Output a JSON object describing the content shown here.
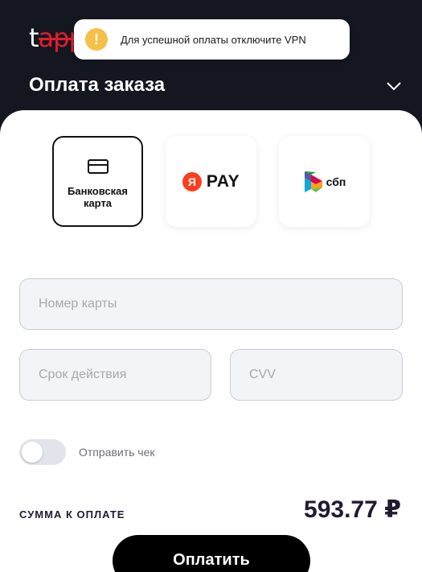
{
  "logo": {
    "part1": "t",
    "part2": "app"
  },
  "toast": {
    "icon": "!",
    "text": "Для успешной оплаты отключите VPN"
  },
  "header": {
    "title": "Оплата заказа"
  },
  "methods": {
    "card": {
      "label_line1": "Банковская",
      "label_line2": "карта"
    },
    "yapay": {
      "logo_letter": "Я",
      "logo_text": "PAY"
    },
    "sbp": {
      "logo_text": "сбп"
    }
  },
  "form": {
    "card_number_placeholder": "Номер карты",
    "expiry_placeholder": "Срок действия",
    "cvv_placeholder": "CVV"
  },
  "receipt": {
    "label": "Отправить чек",
    "enabled": false
  },
  "summary": {
    "label": "СУММА К ОПЛАТЕ",
    "amount": "593.77 ₽"
  },
  "pay_button": {
    "label": "Оплатить"
  },
  "colors": {
    "header_bg": "#141720",
    "toast_icon": "#f5c04a",
    "accent_red": "#e11d2b",
    "ya_red": "#fc3f1d"
  }
}
